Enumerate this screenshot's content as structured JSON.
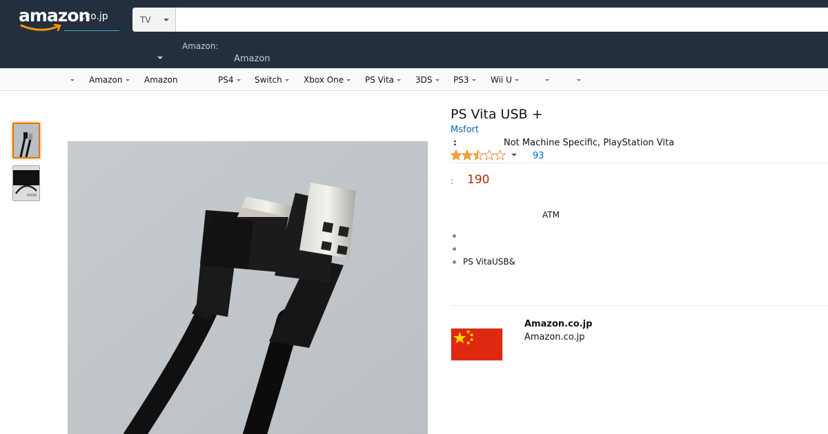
{
  "header": {
    "logo_text": "amazon",
    "logo_tld": ".co.jp",
    "search_category": "TV",
    "search_placeholder": "",
    "deliver_to_label": "Amazon:",
    "deliver_to_value": "Amazon"
  },
  "subnav": {
    "items": [
      {
        "label": "",
        "dropdown": true
      },
      {
        "label": "Amazon",
        "dropdown": true
      },
      {
        "label": "Amazon",
        "dropdown": false
      },
      {
        "label": "PS4",
        "dropdown": true
      },
      {
        "label": "Switch",
        "dropdown": true
      },
      {
        "label": "Xbox One",
        "dropdown": true
      },
      {
        "label": "PS Vita",
        "dropdown": true
      },
      {
        "label": "3DS",
        "dropdown": true
      },
      {
        "label": "PS3",
        "dropdown": true
      },
      {
        "label": "Wii U",
        "dropdown": true
      },
      {
        "label": "",
        "dropdown": true
      },
      {
        "label": "",
        "dropdown": true
      }
    ]
  },
  "product": {
    "title": "PS Vita USB +",
    "brand": "Msfort",
    "platform_key": ":",
    "platform_value": "Not Machine Specific, PlayStation Vita",
    "rating_stars": 2.5,
    "rating_count": "93",
    "price_key": ":",
    "price": "190",
    "payment_note": "ATM",
    "bullets": [
      "",
      "",
      "PS VitaUSB&"
    ]
  },
  "seller": {
    "name": "Amazon.co.jp",
    "sub": "Amazon.co.jp",
    "flag_icon": "china-flag-icon"
  },
  "colors": {
    "header_bg": "#232f3e",
    "link": "#0066c0",
    "price": "#b12704",
    "star": "#ffa41c",
    "thumb_selected": "#e77600"
  }
}
